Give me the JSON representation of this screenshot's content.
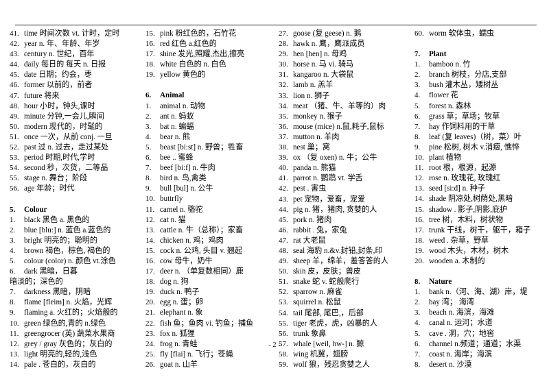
{
  "document": {
    "page_number": "- 2 -",
    "columns": [
      {
        "id": "column-1",
        "blocks": [
          {
            "type": "entries",
            "items": [
              {
                "num": "41.",
                "text": "time  时间次数 vt. 计时，定时"
              },
              {
                "num": "42.",
                "text": "year   n. 年、年龄、年岁"
              },
              {
                "num": "43.",
                "text": "century n. 世纪，百年"
              },
              {
                "num": "44.",
                "text": "daily   每日的 每天 n. 日报"
              },
              {
                "num": "45.",
                "text": "date         日期；约会，枣"
              },
              {
                "num": "46.",
                "text": "former 以前的，前者"
              },
              {
                "num": "47.",
                "text": "future        将来"
              },
              {
                "num": "48.",
                "text": "hour 小时，钟头,课时"
              },
              {
                "num": "49.",
                "text": "minute 分钟,一会儿,瞬间"
              },
              {
                "num": "50.",
                "text": "modern 现代的，时髦的"
              },
              {
                "num": "51.",
                "text": "once 一次，从前 conj. 一旦"
              },
              {
                "num": "52.",
                "text": "past  过 n. 过去，走过某处"
              },
              {
                "num": "53.",
                "text": "period 时期,时代,学时"
              },
              {
                "num": "54.",
                "text": "second 秒，次货，二等品"
              },
              {
                "num": "55.",
                "text": "stage  n. 舞台；阶段"
              },
              {
                "num": "56.",
                "text": "age      年龄；时代"
              }
            ]
          },
          {
            "type": "gap"
          },
          {
            "type": "section",
            "num": "5.",
            "title": "Colour"
          },
          {
            "type": "entries",
            "items": [
              {
                "num": "1.",
                "text": "black 黑色 a. 黑色的"
              },
              {
                "num": "2.",
                "text": "blue [blu:] n. 蓝色 a.蓝色的"
              },
              {
                "num": "3.",
                "text": "bright   明亮的；聪明的"
              },
              {
                "num": "4.",
                "text": "brown 褐色，棕色, 褐色的"
              },
              {
                "num": "5.",
                "text": "colour (color) n. 颜色 vt.涂色"
              },
              {
                "num": "6.",
                "text": "dark   黑暗，日暮"
              }
            ]
          },
          {
            "type": "continuation",
            "text": "暗淡的；深色的"
          },
          {
            "type": "entries",
            "items": [
              {
                "num": "7.",
                "text": "darkness   黑暗，阴暗"
              },
              {
                "num": "8.",
                "text": "flame [fleim] n. 火焰，光辉"
              },
              {
                "num": "9.",
                "text": "flaming a. 火红的；火焰般的"
              },
              {
                "num": "10.",
                "text": "green  绿色的,青的 n.绿色"
              },
              {
                "num": "11.",
                "text": "greengrocer (英) 蔬菜水果商"
              },
              {
                "num": "12.",
                "text": "grey / gray   灰色的；灰白的"
              },
              {
                "num": "13.",
                "text": "light   明亮的,轻的,浅色"
              },
              {
                "num": "14.",
                "text": "pale    . 苍白的，灰白的"
              }
            ]
          }
        ]
      },
      {
        "id": "column-2",
        "blocks": [
          {
            "type": "entries",
            "items": [
              {
                "num": "15.",
                "text": "pink   粉红色的，石竹花"
              },
              {
                "num": "16.",
                "text": "red      红色 a.红色的"
              },
              {
                "num": "17.",
                "text": "shine 发光,照耀,杰出,擦亮"
              },
              {
                "num": "18.",
                "text": "white  白色的 n. 白色"
              },
              {
                "num": "19.",
                "text": "yellow      黄色的"
              }
            ]
          },
          {
            "type": "gap"
          },
          {
            "type": "section",
            "num": "6.",
            "title": "Animal"
          },
          {
            "type": "entries",
            "items": [
              {
                "num": "1.",
                "text": "animal n. 动物"
              },
              {
                "num": "2.",
                "text": "ant n. 蚂蚁"
              },
              {
                "num": "3.",
                "text": "bat   n. 蝙蝠"
              },
              {
                "num": "4.",
                "text": "bear n. 熊"
              },
              {
                "num": "5.",
                "text": "beast [bi:st] n. 野兽；牲畜"
              },
              {
                "num": "6.",
                "text": "bee .. 蜜蜂"
              },
              {
                "num": "7.",
                "text": "beef [bi:f] n. 牛肉"
              },
              {
                "num": "8.",
                "text": "bird n. 鸟,禽类"
              },
              {
                "num": "9.",
                "text": "bull [bul] n. 公牛"
              },
              {
                "num": "10.",
                "text": "buttrfly"
              },
              {
                "num": "11.",
                "text": "camel  n. 骆驼"
              },
              {
                "num": "12.",
                "text": "cat   n. 猫"
              },
              {
                "num": "13.",
                "text": "cattle n. 牛（总称）；家畜"
              },
              {
                "num": "14.",
                "text": "chicken n. 鸡；鸡肉"
              },
              {
                "num": "15.",
                "text": "cock   n. 公鸡, 头目 v. 翘起"
              },
              {
                "num": "16.",
                "text": "cow   母牛，奶牛"
              },
              {
                "num": "17.",
                "text": "deer  n. （单复数相同）鹿"
              },
              {
                "num": "18.",
                "text": "dog n. 狗"
              },
              {
                "num": "19.",
                "text": "duck  n. 鸭子"
              },
              {
                "num": "20.",
                "text": "egg  n. 蛋；卵"
              },
              {
                "num": "21.",
                "text": "elephant  n. 象"
              },
              {
                "num": "22.",
                "text": "fish 鱼；鱼肉 vi. 钓鱼；捕鱼"
              },
              {
                "num": "23.",
                "text": "fox  n. 狐狸"
              },
              {
                "num": "24.",
                "text": "frog n. 青蛙"
              },
              {
                "num": "25.",
                "text": "fly [flai] n. 飞行；苍蝇"
              },
              {
                "num": "26.",
                "text": "goat  n. 山羊"
              }
            ]
          }
        ]
      },
      {
        "id": "column-3",
        "blocks": [
          {
            "type": "entries",
            "items": [
              {
                "num": "27.",
                "text": "goose (复 geese) n. 鹅"
              },
              {
                "num": "28.",
                "text": "hawk  n. 鹰，鹰派成员"
              },
              {
                "num": "29.",
                "text": "hen [hen] n. 母鸡"
              },
              {
                "num": "30.",
                "text": "horse  n. 马 vi. 骑马"
              },
              {
                "num": "31.",
                "text": "kangaroo  n. 大袋鼠"
              },
              {
                "num": "32.",
                "text": "lamb  n. 羔羊"
              },
              {
                "num": "33.",
                "text": "lion  n. 狮子"
              },
              {
                "num": "34.",
                "text": "meat （猪、牛、羊等的）肉"
              },
              {
                "num": "35.",
                "text": "monkey  n. 猴子"
              },
              {
                "num": "36.",
                "text": "mouse  (mice) n.鼠,耗子,鼠标"
              },
              {
                "num": "37.",
                "text": "mutton  n. 羊肉"
              },
              {
                "num": "38.",
                "text": "nest  巢；窝"
              },
              {
                "num": "39.",
                "text": "ox  （复 oxen) n. 牛；公牛"
              },
              {
                "num": "40.",
                "text": "panda n. 熊猫"
              },
              {
                "num": "41.",
                "text": "parrot  n. 鹦鹉 vt. 学舌"
              },
              {
                "num": "42.",
                "text": "pest . 害虫"
              },
              {
                "num": "43.",
                "text": "pet  宠物，爱畜，宠爱"
              },
              {
                "num": "44.",
                "text": "pig  n. 猪，猪肉, 贪婪的人"
              },
              {
                "num": "45.",
                "text": "pork n. 猪肉"
              },
              {
                "num": "46.",
                "text": "rabbit . 兔，家兔"
              },
              {
                "num": "47.",
                "text": "rat    大老鼠"
              },
              {
                "num": "48.",
                "text": "seal 海豹 n.&v.封铅,封条,印"
              },
              {
                "num": "49.",
                "text": "sheep 羊，绵羊，羞答答的人"
              },
              {
                "num": "50.",
                "text": "skin  皮，皮肤；兽皮"
              },
              {
                "num": "51.",
                "text": "snake  蛇 v. 蛇般爬行"
              },
              {
                "num": "52.",
                "text": "sparrow n. 麻雀"
              },
              {
                "num": "53.",
                "text": "squirrel n. 松鼠"
              },
              {
                "num": "54.",
                "text": "tail  尾部, 尾巴,，后部"
              },
              {
                "num": "55.",
                "text": "tiger 老虎，虎，凶暴的人"
              },
              {
                "num": "56.",
                "text": "trunk         象鼻"
              },
              {
                "num": "57.",
                "text": "whale [weil, hw-] n. 鲸"
              },
              {
                "num": "58.",
                "text": "wing 机翼，翅膀"
              },
              {
                "num": "59.",
                "text": "wolf  狼，残忍贪婪之人"
              }
            ]
          }
        ]
      },
      {
        "id": "column-4",
        "blocks": [
          {
            "type": "entries",
            "items": [
              {
                "num": "60.",
                "text": "worm 软体虫，蠕虫"
              }
            ]
          },
          {
            "type": "gap"
          },
          {
            "type": "section",
            "num": "7.",
            "title": "Plant"
          },
          {
            "type": "entries",
            "items": [
              {
                "num": "1.",
                "text": "bamboo n. 竹"
              },
              {
                "num": "2.",
                "text": "branch 树枝，分店,支部"
              },
              {
                "num": "3.",
                "text": "bush 灌木丛，矮树丛"
              },
              {
                "num": "4.",
                "text": "flower   花"
              },
              {
                "num": "5.",
                "text": "forest n. 森林"
              },
              {
                "num": "6.",
                "text": "grass 草；草场；牧草"
              },
              {
                "num": "7.",
                "text": "hay 作饲料用的干草"
              },
              {
                "num": "8.",
                "text": "leaf  (复 leaves)（树，菜）叶"
              },
              {
                "num": "9.",
                "text": "pine 松树, 树木 v.消瘦, 憔悴"
              },
              {
                "num": "10.",
                "text": "plant   植物"
              },
              {
                "num": "11.",
                "text": "root 根，根源，起源"
              },
              {
                "num": "12.",
                "text": "rose  n. 玫瑰花, 玫瑰红"
              },
              {
                "num": "13.",
                "text": "seed [si:d] n. 种子"
              },
              {
                "num": "14.",
                "text": "shade 阴凉处,树荫处,黑暗"
              },
              {
                "num": "15.",
                "text": "shadow . 影子,阴影,庇护"
              },
              {
                "num": "16.",
                "text": "tree  树，木料，树状物"
              },
              {
                "num": "17.",
                "text": "trunk 干线，树干，躯干，箱子"
              },
              {
                "num": "18.",
                "text": "weed   . 杂草，野草"
              },
              {
                "num": "19.",
                "text": "wood  木头，木材，树木"
              },
              {
                "num": "20.",
                "text": "wooden a. 木制的"
              }
            ]
          },
          {
            "type": "gap"
          },
          {
            "type": "section",
            "num": "8.",
            "title": "Nature"
          },
          {
            "type": "entries",
            "items": [
              {
                "num": "1.",
                "text": "bank n.（河、海、湖）岸，堤"
              },
              {
                "num": "2.",
                "text": "bay 湾；  海湾"
              },
              {
                "num": "3.",
                "text": "beach  n. 海滨，海滩"
              },
              {
                "num": "4.",
                "text": "canal n. 运河；水道"
              },
              {
                "num": "5.",
                "text": "cave . 洞，穴；地窖"
              },
              {
                "num": "6.",
                "text": "channel  n.频道；通道；水渠"
              },
              {
                "num": "7.",
                "text": "coast  n. 海岸；海滨"
              },
              {
                "num": "8.",
                "text": "desert  n. 沙漠"
              }
            ]
          }
        ]
      }
    ]
  }
}
